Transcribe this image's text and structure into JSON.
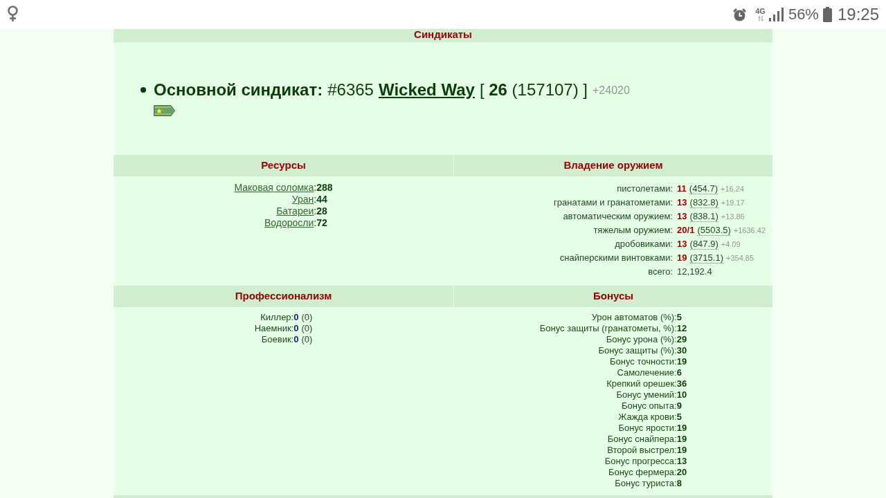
{
  "status_bar": {
    "network": "4G",
    "battery": "56%",
    "time": "19:25"
  },
  "syndicates": {
    "title": "Синдикаты",
    "items": [
      {
        "label": "Основной синдикат:",
        "id": "#6365",
        "name": "Wicked Way",
        "rank": "[ **26** (157107) ]",
        "gain": "+24020"
      }
    ]
  },
  "resources": {
    "title": "Ресурсы",
    "rows": [
      {
        "name": "Маковая соломка",
        "value": ":**288**"
      },
      {
        "name": "Уран",
        "value": ":**44**"
      },
      {
        "name": "Батареи",
        "value": ":**28**"
      },
      {
        "name": "Водоросли",
        "value": ":**72**"
      }
    ]
  },
  "weapons": {
    "title": "Владение оружием",
    "rows": [
      {
        "kind": "skill",
        "name": "пистолетами:",
        "skill": "11",
        "experience": "(454.7)",
        "gain": "+16.24"
      },
      {
        "kind": "skill",
        "name": "гранатами и гранатометами:",
        "skill": "13",
        "experience": "(832.8)",
        "gain": "+19.17"
      },
      {
        "kind": "skill",
        "name": "автоматическим оружием:",
        "skill": "13",
        "experience": "(838.1)",
        "gain": "+13.86"
      },
      {
        "kind": "skill",
        "name": "тяжелым оружием:",
        "skill": "20/1",
        "experience": "(5503.5)",
        "gain": "+1636.42"
      },
      {
        "kind": "skill",
        "name": "дробовиками:",
        "skill": "13",
        "experience": "(847.9)",
        "gain": "+4.09"
      },
      {
        "kind": "skill",
        "name": "снайперскими винтовками:",
        "skill": "19",
        "experience": "(3715.1)",
        "gain": "+354.85"
      },
      {
        "kind": "total",
        "name": "всего:",
        "value": "12,192.4"
      }
    ]
  },
  "professionalism": {
    "title": "Профессионализм",
    "rows": [
      {
        "name": "Киллер:",
        "value": "0",
        "extra": "(0)"
      },
      {
        "name": "Наемник:",
        "value": "0",
        "extra": "(0)"
      },
      {
        "name": "Боевик:",
        "value": "0",
        "extra": "(0)"
      }
    ]
  },
  "bonuses": {
    "title": "Бонусы",
    "rows": [
      {
        "name": "Урон автоматов (%):",
        "value": "5"
      },
      {
        "name": "Бонус защиты (гранатометы, %):",
        "value": "12"
      },
      {
        "name": "Бонус урона (%):",
        "value": "29"
      },
      {
        "name": "Бонус защиты (%):",
        "value": "30"
      },
      {
        "name": "Бонус точности:",
        "value": "19"
      },
      {
        "name": "Самолечение:",
        "value": "6"
      },
      {
        "name": "Крепкий орешек:",
        "value": "36"
      },
      {
        "name": "Бонус умений:",
        "value": "10"
      },
      {
        "name": "Бонус опыта:",
        "value": "9"
      },
      {
        "name": "Жажда крови:",
        "value": "5"
      },
      {
        "name": "Бонус ярости:",
        "value": "19"
      },
      {
        "name": "Бонус снайпера:",
        "value": "19"
      },
      {
        "name": "Второй выстрел:",
        "value": "19"
      },
      {
        "name": "Бонус прогресса:",
        "value": "13"
      },
      {
        "name": "Бонус фермера:",
        "value": "20"
      },
      {
        "name": "Бонус туриста:",
        "value": "8"
      }
    ]
  }
}
